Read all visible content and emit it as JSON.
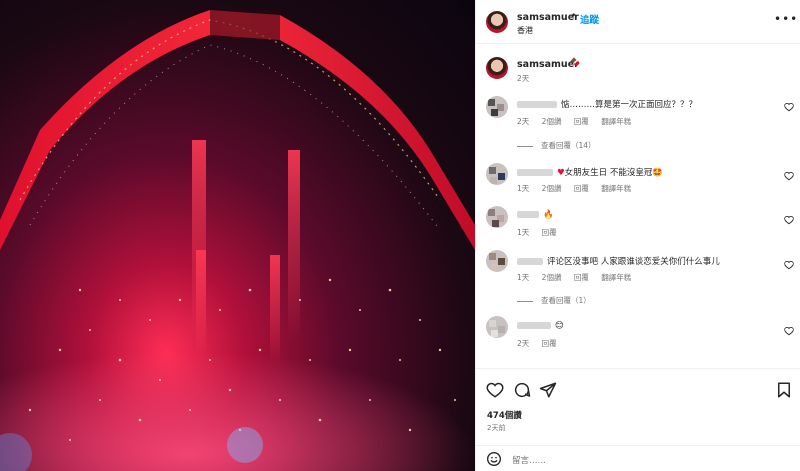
{
  "post": {
    "username": "samsamuer",
    "follow_label": "追蹤",
    "location": "香港",
    "more_icon": "more-horizontal-icon"
  },
  "caption": {
    "username": "samsamuer",
    "emoji": "🍫",
    "time": "2天"
  },
  "comments": [
    {
      "text": "惦………算是第一次正面回应？？？",
      "time": "2天",
      "likes": "2個讚",
      "reply": "回覆",
      "translate": "翻譯年糕",
      "view_replies": "查看回覆（14）"
    },
    {
      "text": "女朋友生日 不能沒皇冠🤩",
      "time": "1天",
      "likes": "2個讚",
      "reply": "回覆",
      "translate": "翻譯年糕"
    },
    {
      "text": "🔥",
      "time": "1天",
      "reply": "回覆"
    },
    {
      "text": "评论区没事吧 人家跟谁谈恋爱关你们什么事儿",
      "time": "1天",
      "likes": "2個讚",
      "reply": "回覆",
      "translate": "翻譯年糕",
      "view_replies": "查看回覆（1）"
    },
    {
      "text": "😊",
      "time": "2天",
      "reply": "回覆"
    }
  ],
  "actions": {
    "likes": "474個讚",
    "posted": "2天前",
    "comment_placeholder": "留言……"
  },
  "icons": {
    "heart": "heart-icon",
    "comment": "comment-icon",
    "share": "share-icon",
    "save": "bookmark-icon",
    "emoji": "emoji-icon"
  },
  "colors": {
    "accent": "#0095f6",
    "text": "#262626",
    "muted": "#737373",
    "red": "#e8112d"
  }
}
